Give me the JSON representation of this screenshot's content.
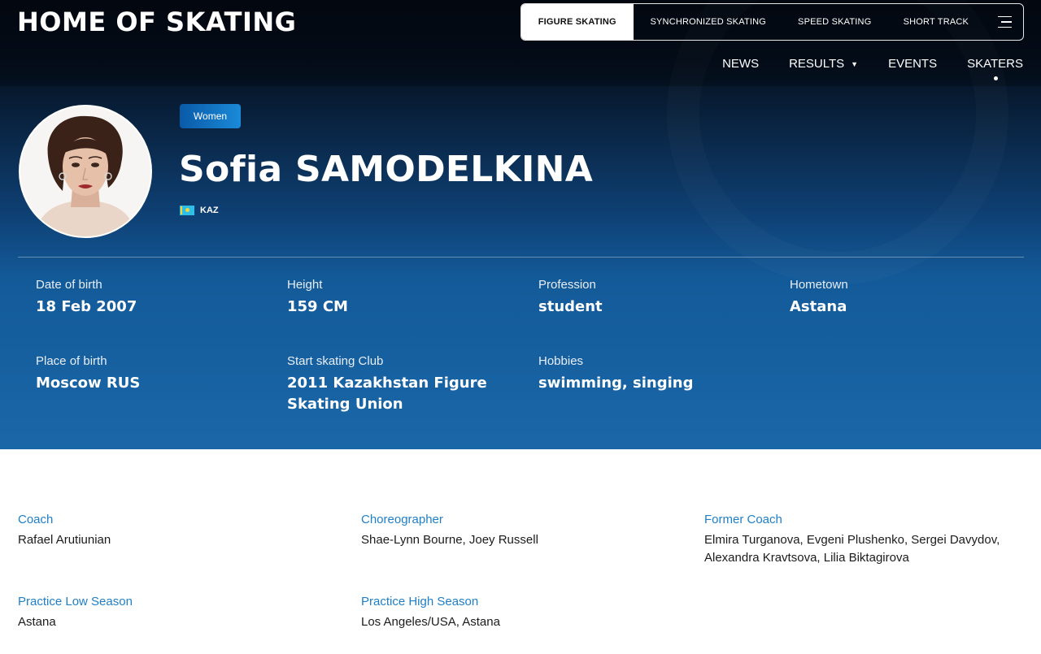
{
  "site": {
    "title": "HOME OF SKATING"
  },
  "discipline_tabs": [
    {
      "label": "FIGURE SKATING",
      "active": true
    },
    {
      "label": "SYNCHRONIZED SKATING",
      "active": false
    },
    {
      "label": "SPEED SKATING",
      "active": false
    },
    {
      "label": "SHORT TRACK",
      "active": false
    }
  ],
  "menu_icon": "hamburger-icon",
  "main_nav": {
    "news": "NEWS",
    "results": "RESULTS",
    "events": "EVENTS",
    "skaters": "SKATERS",
    "active": "SKATERS"
  },
  "profile": {
    "category": "Women",
    "name": "Sofia SAMODELKINA",
    "country_code": "KAZ",
    "flag_colors": {
      "field": "#2dbfe8",
      "emblem": "#f2d43a"
    }
  },
  "stats": {
    "dob_label": "Date of birth",
    "dob_value": "18 Feb 2007",
    "height_label": "Height",
    "height_value": "159 CM",
    "profession_label": "Profession",
    "profession_value": "student",
    "hometown_label": "Hometown",
    "hometown_value": "Astana",
    "pob_label": "Place of birth",
    "pob_value": "Moscow RUS",
    "club_label": "Start skating Club",
    "club_value": "2011 Kazakhstan Figure Skating Union",
    "hobbies_label": "Hobbies",
    "hobbies_value": "swimming, singing"
  },
  "details": {
    "coach_label": "Coach",
    "coach_value": "Rafael Arutiunian",
    "choreo_label": "Choreographer",
    "choreo_value": "Shae-Lynn Bourne, Joey Russell",
    "former_label": "Former Coach",
    "former_value": "Elmira Turganova, Evgeni Plushenko, Sergei Davydov, Alexandra Kravtsova, Lilia Biktagirova",
    "low_label": "Practice Low Season",
    "low_value": "Astana",
    "high_label": "Practice High Season",
    "high_value": "Los Angeles/USA, Astana"
  },
  "colors": {
    "accent": "#1f7fc7",
    "hero_dark": "#05101f",
    "hero_blue": "#1a67a8"
  }
}
